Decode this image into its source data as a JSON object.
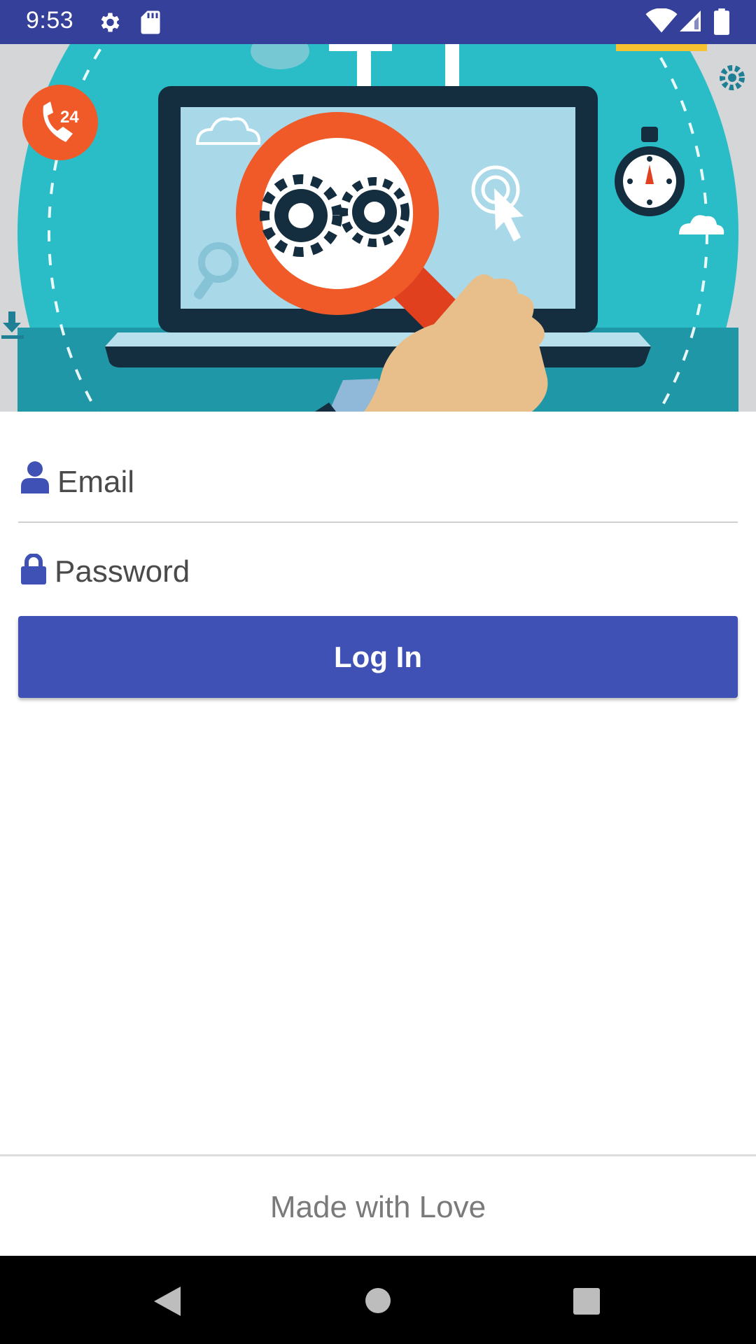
{
  "status_bar": {
    "time": "9:53",
    "left_icons": [
      "gear-icon",
      "sd-card-icon"
    ],
    "right_icons": [
      "wifi-icon",
      "cell-signal-icon",
      "battery-icon"
    ],
    "background": "#35409a"
  },
  "hero": {
    "description_icons": [
      "phone-24-icon",
      "laptop-icon",
      "magnifier-icon",
      "gears-icon",
      "cursor-icon",
      "stopwatch-icon",
      "cloud-icon"
    ]
  },
  "login_form": {
    "email": {
      "placeholder": "Email",
      "value": "",
      "icon": "person-icon"
    },
    "password": {
      "placeholder": "Password",
      "value": "",
      "icon": "lock-icon"
    },
    "submit_label": "Log In"
  },
  "footer": {
    "text": "Made with Love"
  },
  "nav_bar": {
    "buttons": [
      "back-icon",
      "home-icon",
      "recents-icon"
    ]
  },
  "colors": {
    "primary": "#3f51b5",
    "status_bar": "#35409a",
    "hero_teal": "#2bbdc7",
    "accent_orange": "#f05a28"
  }
}
